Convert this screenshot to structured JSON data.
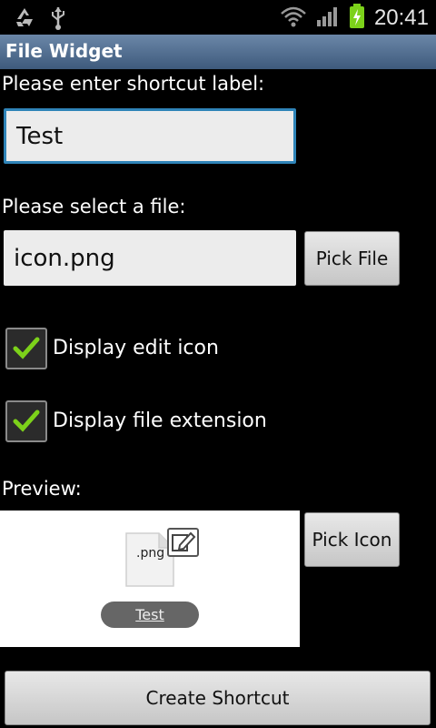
{
  "status_bar": {
    "time": "20:41",
    "icons": [
      "recycle-icon",
      "usb-icon",
      "wifi-icon",
      "signal-icon",
      "battery-charging-icon"
    ]
  },
  "app": {
    "title": "File Widget"
  },
  "form": {
    "label_prompt": "Please enter shortcut label:",
    "label_value": "Test",
    "file_prompt": "Please select a file:",
    "file_value": "icon.png",
    "pick_file_button": "Pick File",
    "checkbox_edit_icon": {
      "label": "Display edit icon",
      "checked": true
    },
    "checkbox_file_ext": {
      "label": "Display file extension",
      "checked": true
    },
    "preview_label": "Preview:",
    "preview": {
      "extension": ".png",
      "shortcut_label": "Test",
      "icons": [
        "file-icon",
        "edit-icon"
      ]
    },
    "pick_icon_button": "Pick Icon",
    "create_button": "Create Shortcut"
  },
  "colors": {
    "title_bar": "#4a6a8e",
    "focus_border": "#2f84b8",
    "check_green": "#7cd11a"
  }
}
